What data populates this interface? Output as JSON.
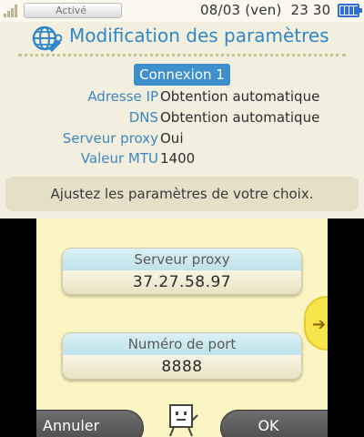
{
  "status_bar": {
    "status_label": "Activé",
    "date": "08/03 (ven)",
    "time": "23 30"
  },
  "header": {
    "title": "Modification des paramètres",
    "icon": "globe-wrench-icon"
  },
  "connection": {
    "badge": "Connexion 1",
    "rows": [
      {
        "label": "Adresse IP",
        "value": "Obtention automatique"
      },
      {
        "label": "DNS",
        "value": "Obtention automatique"
      },
      {
        "label": "Serveur proxy",
        "value": "Oui"
      },
      {
        "label": "Valeur MTU",
        "value": "1400"
      }
    ]
  },
  "message": "Ajustez les paramètres de votre choix.",
  "form": {
    "proxy": {
      "label": "Serveur proxy",
      "value": "37.27.58.97"
    },
    "port": {
      "label": "Numéro de port",
      "value": "8888"
    }
  },
  "footer": {
    "cancel": "Annuler",
    "ok": "OK"
  },
  "colors": {
    "accent": "#3f8fcd",
    "top_bg": "#f3efdf",
    "bottom_bg": "#fbf4c3"
  }
}
